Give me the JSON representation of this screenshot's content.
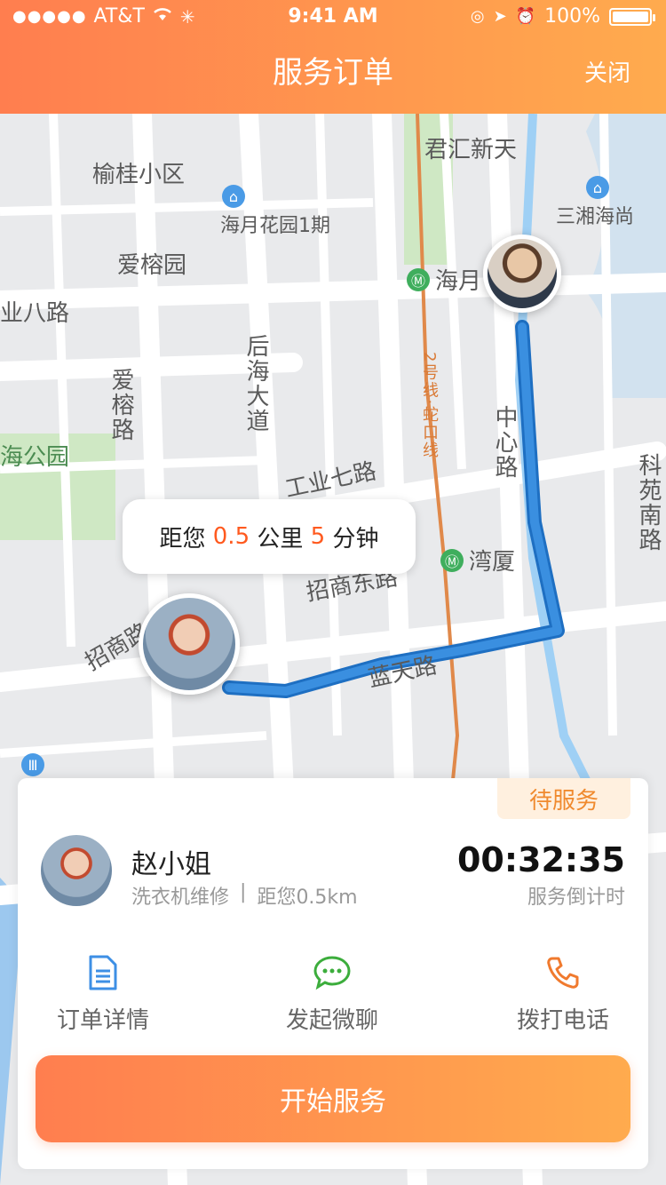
{
  "status_bar": {
    "carrier": "AT&T",
    "time": "9:41 AM",
    "battery": "100%"
  },
  "header": {
    "title": "服务订单",
    "close_label": "关闭"
  },
  "map": {
    "labels": {
      "yugui": "榆桂小区",
      "haiyue_garden": "海月花园1期",
      "aigong_garden": "爱榕园",
      "gongye8": "业八路",
      "aigong_road": "爱榕路",
      "houhai": "后海大道",
      "haiyue_station": "海月",
      "junhui": "君汇新天",
      "sanxiang": "三湘海尚",
      "line2": "2号线·蛇口线",
      "zhongxin": "中心路",
      "kejinan": "科苑南路",
      "gongye7": "工业七路",
      "wanxia": "湾厦",
      "zhaoshang_east": "招商东路",
      "zhaoshang": "招商路",
      "wanhuan_lu": "蓝天路",
      "hai_park": "海公园"
    },
    "tooltip": {
      "prefix": "距您",
      "distance": "0.5",
      "distance_unit": "公里",
      "minutes": "5",
      "minutes_unit": "分钟"
    }
  },
  "order": {
    "status": "待服务",
    "customer_name": "赵小姐",
    "service": "洗衣机维修",
    "separator": "|",
    "distance": "距您0.5km",
    "countdown": "00:32:35",
    "countdown_label": "服务倒计时",
    "actions": [
      {
        "label": "订单详情",
        "icon": "document-icon"
      },
      {
        "label": "发起微聊",
        "icon": "chat-icon"
      },
      {
        "label": "拨打电话",
        "icon": "phone-icon"
      }
    ],
    "start_button": "开始服务"
  },
  "colors": {
    "accent_start": "#ff7e4f",
    "accent_end": "#ffab4e",
    "route": "#2f7fd0",
    "highlight": "#ff5a1f"
  }
}
